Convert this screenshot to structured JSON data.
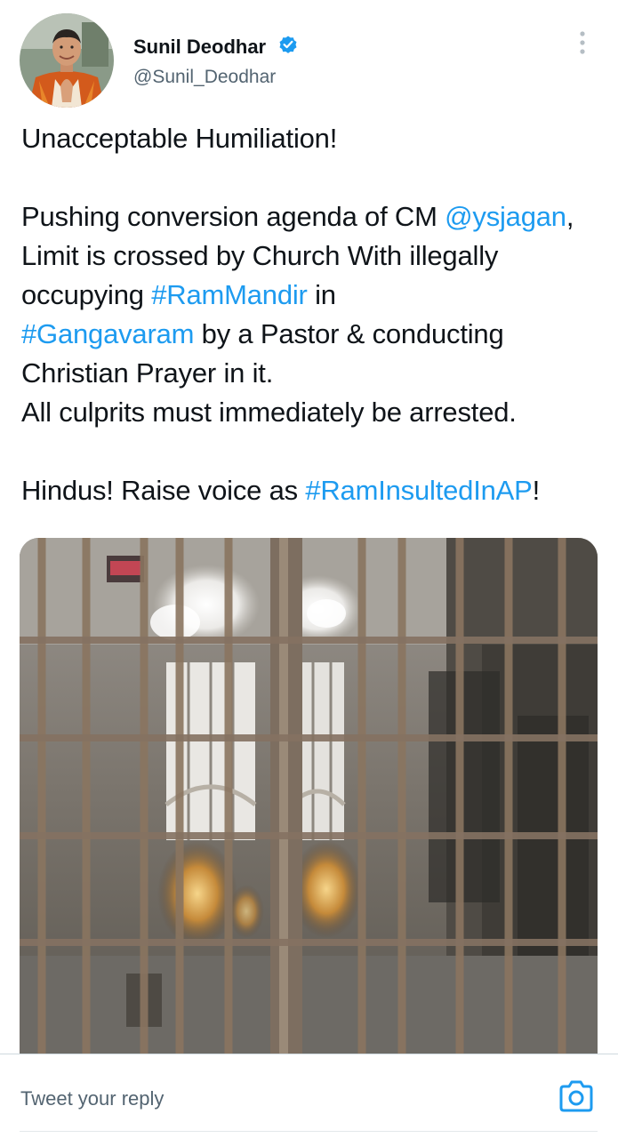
{
  "author": {
    "display_name": "Sunil Deodhar",
    "handle": "@Sunil_Deodhar",
    "verified": true,
    "verified_icon": "verified-badge-icon"
  },
  "tweet": {
    "line1": "Unacceptable Humiliation!",
    "para2_a": "Pushing conversion agenda of CM ",
    "mention": "@ysjagan",
    "para2_b": ", Limit is crossed by Church With illegally occupying ",
    "hashtag1": "#RamMandir",
    "para2_c": " in ",
    "hashtag2": "#Gangavaram",
    "para2_d": " by a Pastor & conducting Christian Prayer in it.",
    "line3": "All culprits must immediately be arrested.",
    "para4_a": "Hindus! Raise voice as ",
    "hashtag3": "#RamInsultedInAP",
    "para4_b": "!"
  },
  "reply": {
    "placeholder": "Tweet your reply",
    "camera_icon": "camera-icon"
  },
  "colors": {
    "link": "#1d9bf0",
    "text": "#0f1419",
    "secondary": "#536471",
    "verified": "#1d9bf0"
  }
}
